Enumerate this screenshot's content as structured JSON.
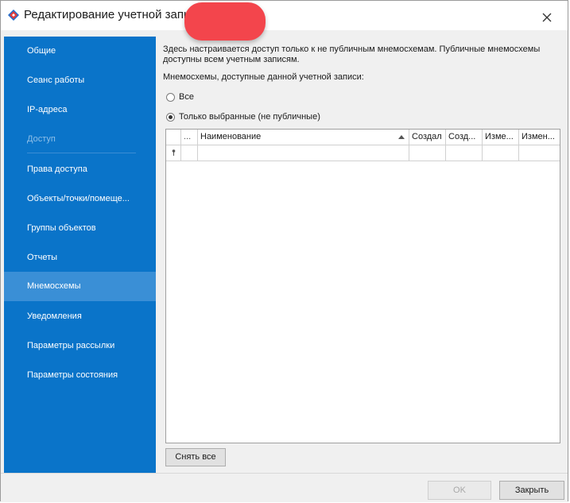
{
  "window": {
    "title": "Редактирование учетной запис"
  },
  "sidebar": {
    "items": [
      {
        "label": "Общие",
        "state": "normal"
      },
      {
        "label": "Сеанс работы",
        "state": "normal"
      },
      {
        "label": "IP-адреса",
        "state": "normal"
      },
      {
        "label": "Доступ",
        "state": "disabled"
      },
      {
        "label": "Права доступа",
        "state": "normal"
      },
      {
        "label": "Объекты/точки/помеще...",
        "state": "normal"
      },
      {
        "label": "Группы объектов",
        "state": "normal"
      },
      {
        "label": "Отчеты",
        "state": "normal"
      },
      {
        "label": "Мнемосхемы",
        "state": "active"
      },
      {
        "label": "Уведомления",
        "state": "normal"
      },
      {
        "label": "Параметры рассылки",
        "state": "normal"
      },
      {
        "label": "Параметры состояния",
        "state": "normal"
      }
    ]
  },
  "content": {
    "info_line1": "Здесь настраивается доступ только к не публичным мнемосхемам. Публичные мнемосхемы",
    "info_line2": "доступны всем учетным записям.",
    "subtitle": "Мнемосхемы, доступные данной учетной записи:",
    "radio_all": "Все",
    "radio_selected": "Только выбранные (не публичные)",
    "selected_option": "Только выбранные (не публичные)"
  },
  "grid": {
    "columns": [
      "...",
      "Наименование",
      "Создал",
      "Созд...",
      "Изме...",
      "Измен..."
    ],
    "sort_column": "Наименование",
    "rows": []
  },
  "buttons": {
    "clear_all": "Снять все",
    "ok": "OK",
    "close": "Закрыть"
  },
  "colors": {
    "sidebar_bg": "#0a74c9",
    "sidebar_active": "#3a8fd6",
    "redaction": "#f3454c"
  }
}
